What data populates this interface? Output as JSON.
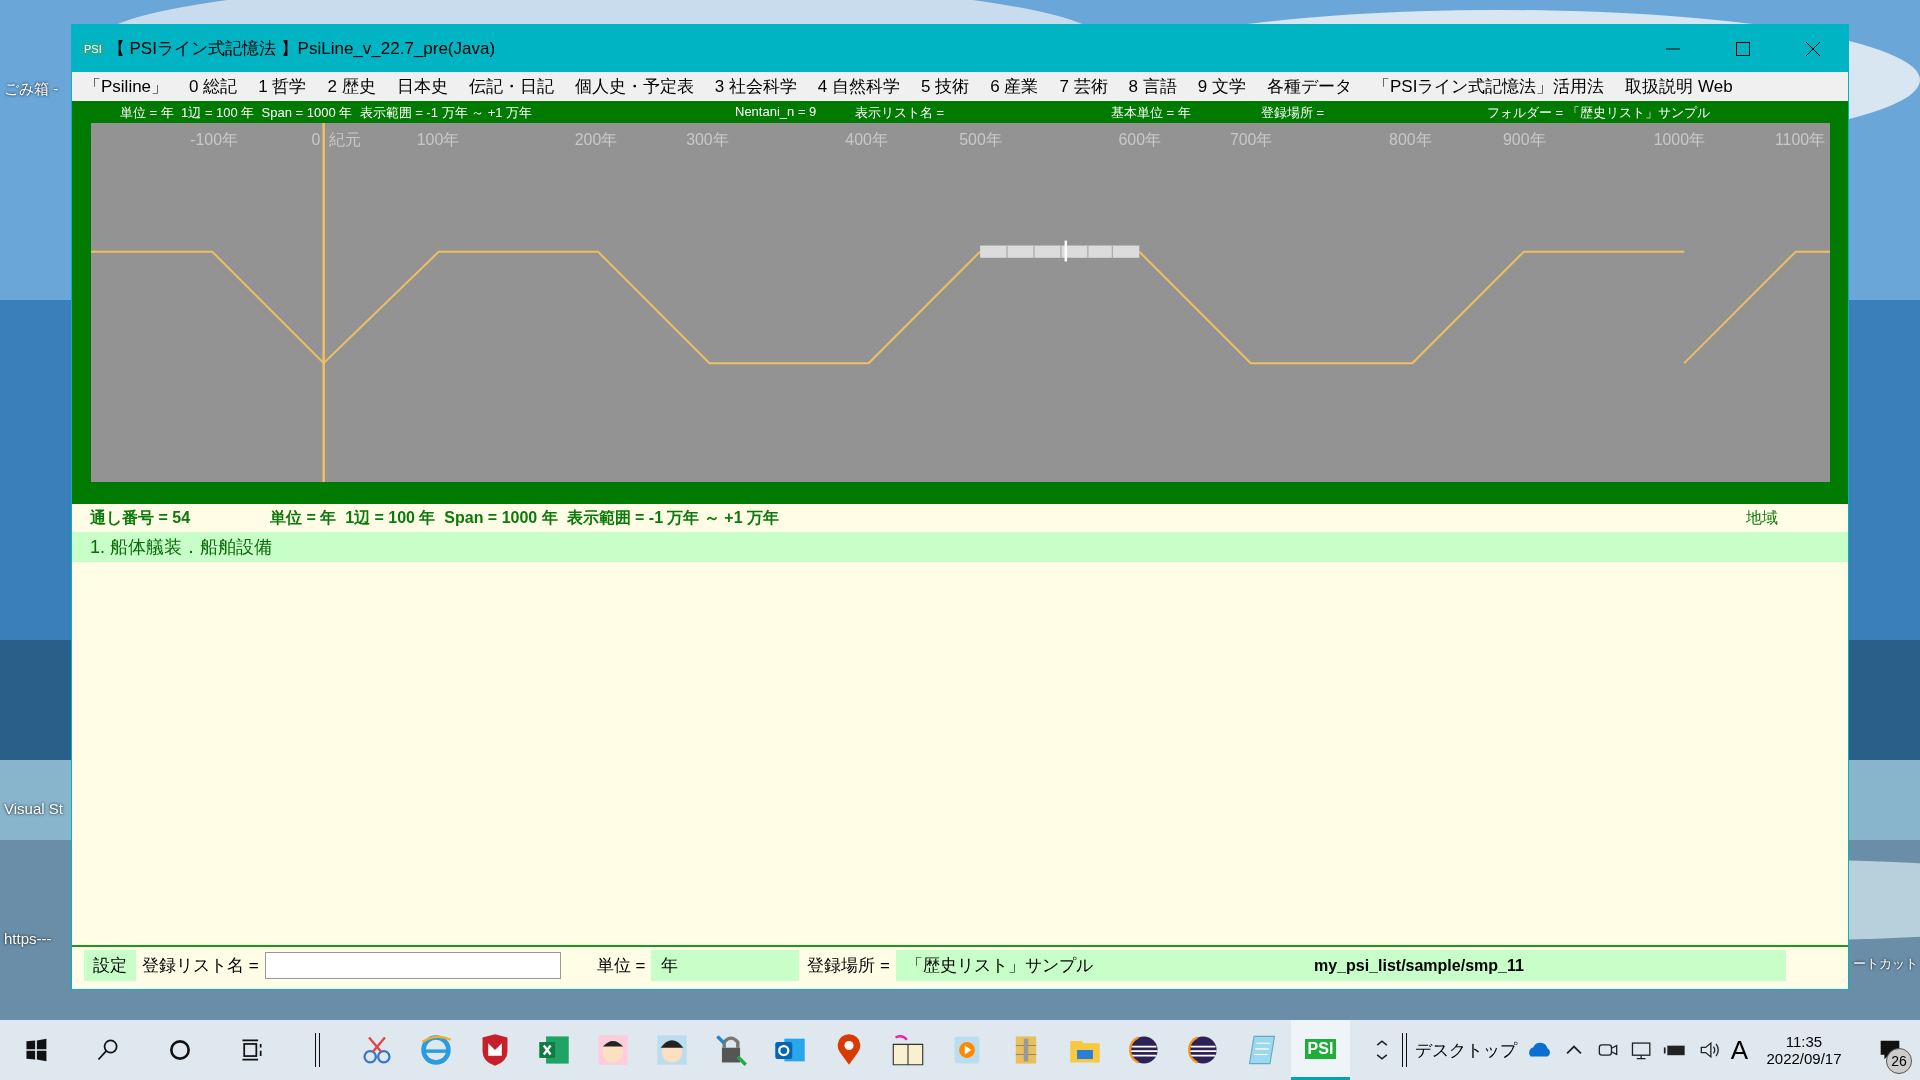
{
  "desktop": {
    "left_icons": [
      {
        "label": "ごみ箱 -"
      },
      {
        "label": "Visual St"
      },
      {
        "label": "https---"
      }
    ],
    "right_icons": [
      {
        "label": "ートカット"
      }
    ]
  },
  "window": {
    "badge": "PSI",
    "title": "【 PSIライン式記憶法 】PsiLine_v_22.7_pre(Java)"
  },
  "menu": [
    "「Psiline」",
    "0 総記",
    "1 哲学",
    "2 歴史",
    "日本史",
    "伝記・日記",
    "個人史・予定表",
    "3 社会科学",
    "4 自然科学",
    "5 技術",
    "6 産業",
    "7 芸術",
    "8 言語",
    "9 文学",
    "各種データ",
    "「PSIライン式記憶法」活用法",
    "取扱説明 Web"
  ],
  "timeline": {
    "header": [
      "単位 = 年  1辺 = 100 年  Span = 1000 年  表示範囲 = -1 万年 ～ +1 万年",
      "Nentani_n = 9",
      "表示リスト名 =",
      "基本単位 = 年",
      "登録場所 =",
      "フォルダー = 「歴史リスト」サンプル"
    ],
    "ticks": [
      "-100年",
      "0",
      "紀元",
      "100年",
      "200年",
      "300年",
      "400年",
      "500年",
      "600年",
      "700年",
      "800年",
      "900年",
      "1000年",
      "1100年"
    ]
  },
  "info": {
    "serial": "通し番号 = 54",
    "summary": "単位 = 年  1辺 = 100 年  Span = 1000 年  表示範囲 = -1 万年 ～ +1 万年",
    "region": "地域"
  },
  "items": [
    {
      "label": "1. 船体艤装．船舶設備"
    }
  ],
  "footer": {
    "settings": "設定",
    "list_label": "登録リスト名 =",
    "unit_label": "単位 =",
    "unit_value": "年",
    "place_label": "登録場所 =",
    "place_value": "「歴史リスト」サンプル",
    "path": "my_psi_list/sample/smp_11"
  },
  "taskbar": {
    "app": "PSI",
    "desktop": "デスクトップ",
    "ime": "A",
    "time": "11:35",
    "date": "2022/09/17",
    "notifications": "26"
  }
}
